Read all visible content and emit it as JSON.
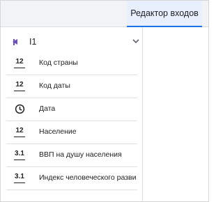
{
  "header": {
    "active_tab": "Редактор входов"
  },
  "group": {
    "title": "I1"
  },
  "fields": [
    {
      "type_icon": "12",
      "icon_name": "integer-type-icon",
      "label": "Код страны"
    },
    {
      "type_icon": "12",
      "icon_name": "integer-type-icon",
      "label": "Код даты"
    },
    {
      "type_icon": "",
      "icon_name": "clock-icon",
      "label": "Дата"
    },
    {
      "type_icon": "12",
      "icon_name": "integer-type-icon",
      "label": "Население"
    },
    {
      "type_icon": "3.1",
      "icon_name": "decimal-type-icon",
      "label": "ВВП на душу населения"
    },
    {
      "type_icon": "3.1",
      "icon_name": "decimal-type-icon",
      "label": "Индекс человеческого разви…"
    }
  ],
  "colors": {
    "accent": "#1a73e8",
    "back_icon": "#6b4fbb"
  }
}
